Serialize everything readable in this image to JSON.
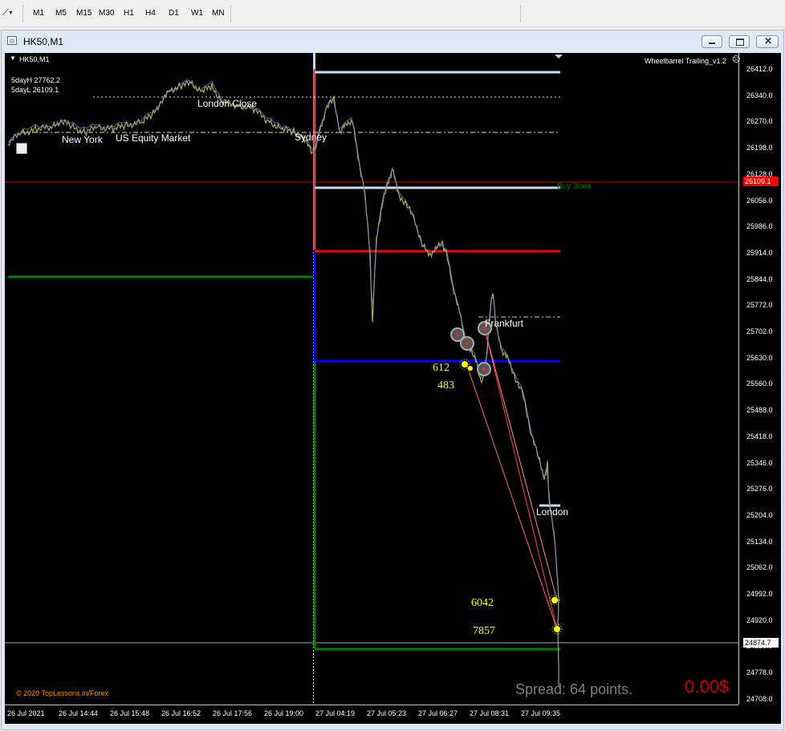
{
  "toolbar": {
    "timeframes": [
      "M1",
      "M5",
      "M15",
      "M30",
      "H1",
      "H4",
      "D1",
      "W1",
      "MN"
    ]
  },
  "window": {
    "title": "HK50,M1"
  },
  "chart": {
    "symbol_label": "HK50,M1",
    "day_high": "5dayH 27762.2",
    "day_low": "5dayL 26109.1",
    "indicator_name": "Wheelbarrel Trailing_v1.2",
    "copyright": "© 2020 TopLessons.In/Forex",
    "spread_text": "Spread: 64 points.",
    "profit": "0.00$",
    "buy_zone": "Buy Зона",
    "sessions": {
      "london_close": "London Close",
      "new_york": "New York",
      "us_equity": "US Equity Market",
      "sydney": "Sydney",
      "frankfurt": "Frankfurt",
      "london": "London"
    },
    "numbers": {
      "n1": "612",
      "n2": "483",
      "n3": "6042",
      "n4": "7857"
    },
    "price_axis": [
      "26412.0",
      "26340.0",
      "26270.0",
      "26198.0",
      "26128.0",
      "26056.0",
      "25986.0",
      "25914.0",
      "25844.0",
      "25772.0",
      "25702.0",
      "25630.0",
      "25560.0",
      "25488.0",
      "25418.0",
      "25346.0",
      "25276.0",
      "25204.0",
      "25134.0",
      "25062.0",
      "24992.0",
      "24920.0",
      "24850.0",
      "24778.0",
      "24708.0"
    ],
    "red_price_tag": "26109.1",
    "current_price_tag": "24874.7",
    "time_axis": [
      "26 Jul 2021",
      "26 Jul 14:44",
      "26 Jul 15:48",
      "26 Jul 16:52",
      "26 Jul 17:56",
      "26 Jul 19:00",
      "27 Jul 04:19",
      "27 Jul 05:23",
      "27 Jul 06:27",
      "27 Jul 08:31",
      "27 Jul 09:35"
    ]
  },
  "colors": {
    "price_line": "#a8ad5a",
    "price_line_alt": "#6a8fd0",
    "red": "#ff0000",
    "blue": "#0000ff",
    "green": "#008000",
    "light_blue": "#c5daf0",
    "yellow": "#ffff00",
    "orange": "#ff9900"
  }
}
